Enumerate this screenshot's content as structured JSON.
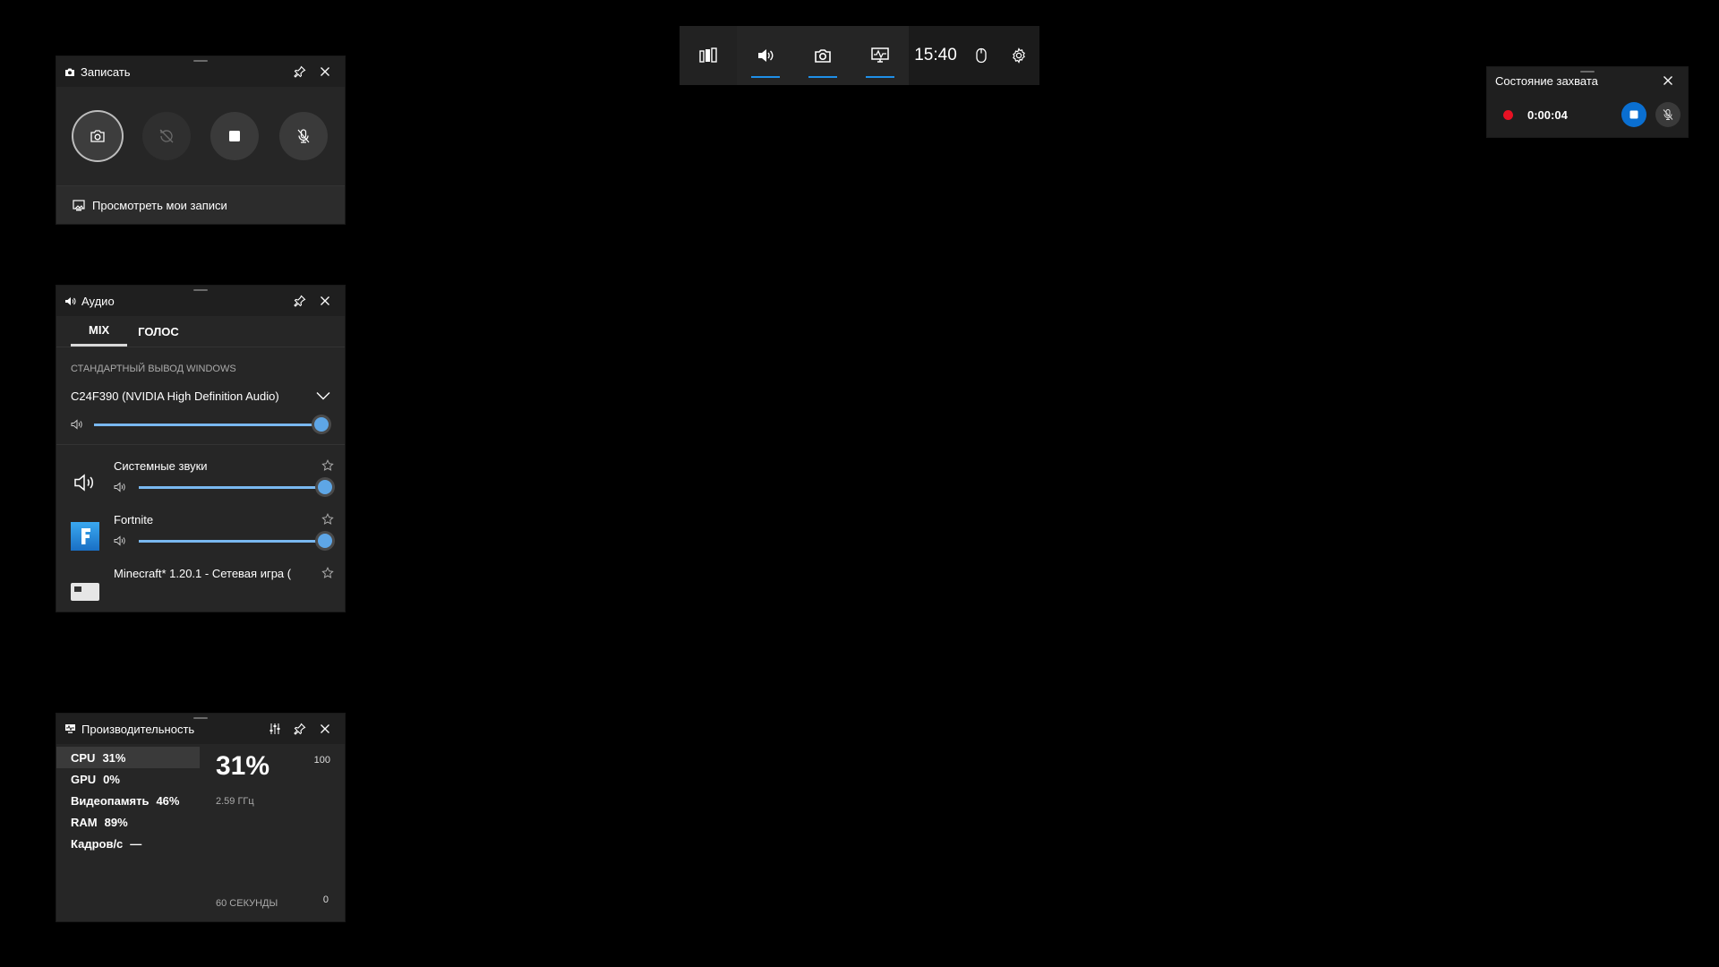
{
  "gamebar": {
    "time": "15:40",
    "icons": [
      "widget-menu-icon",
      "audio-icon",
      "capture-icon",
      "performance-icon",
      "mouse-icon",
      "settings-icon"
    ]
  },
  "capture": {
    "title": "Записать",
    "footer_label": "Просмотреть мои записи"
  },
  "audio": {
    "title": "Аудио",
    "tabs": [
      "MIX",
      "ГОЛОС"
    ],
    "section_label": "СТАНДАРТНЫЙ ВЫВОД WINDOWS",
    "device": "C24F390 (NVIDIA High Definition Audio)",
    "master_volume": 1.0,
    "apps": [
      {
        "name": "Системные звуки",
        "volume": 1.0
      },
      {
        "name": "Fortnite",
        "volume": 1.0
      },
      {
        "name": "Minecraft* 1.20.1 - Сетевая игра (",
        "volume": 1.0
      }
    ]
  },
  "performance": {
    "title": "Производительность",
    "items": [
      {
        "label": "CPU",
        "value": "31%"
      },
      {
        "label": "GPU",
        "value": "0%"
      },
      {
        "label": "Видеопамять",
        "value": "46%"
      },
      {
        "label": "RAM",
        "value": "89%"
      },
      {
        "label": "Кадров/с",
        "value": "—"
      }
    ],
    "big_value": "31%",
    "frequency": "2.59 ГГц",
    "max": "100",
    "min": "0",
    "time_label": "60 СЕКУНДЫ"
  },
  "status": {
    "title": "Состояние захвата",
    "elapsed": "0:00:04"
  },
  "colors": {
    "accent": "#1f8fe8",
    "slider": "#79b8f0",
    "record": "#e81123",
    "stop": "#0a6fd1"
  }
}
